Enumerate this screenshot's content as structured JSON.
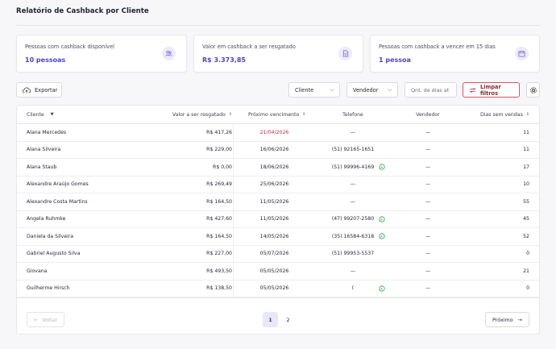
{
  "page": {
    "title": "Relatório de Cashback por Cliente"
  },
  "cards": [
    {
      "label": "Pessoas com cashback disponível",
      "value": "10 pessoas",
      "icon": "people-icon"
    },
    {
      "label": "Valor em cashback a ser resgatado",
      "value": "R$ 3.373,85",
      "icon": "document-icon"
    },
    {
      "label": "Pessoas com cashback a vencer em 15 dias",
      "value": "1 pessoa",
      "icon": "calendar-icon"
    }
  ],
  "toolbar": {
    "export_label": "Exportar",
    "client_filter": "Cliente",
    "seller_filter": "Vendedor",
    "days_placeholder": "Qnt. de dias at",
    "clear_label": "Limpar filtros"
  },
  "table": {
    "headers": {
      "cliente": "Cliente",
      "valor": "Valor a ser resgatado",
      "proximo": "Próximo vencimento",
      "telefone": "Telefone",
      "vendedor": "Vendedor",
      "dias": "Dias sem vendas"
    },
    "rows": [
      {
        "cliente": "Alana Mercedes",
        "valor": "R$ 417,26",
        "proximo": "21/04/2026",
        "telefone": "—",
        "whatsapp": false,
        "vendedor": "—",
        "dias": "11",
        "soon": true
      },
      {
        "cliente": "Alana Silveira",
        "valor": "R$ 229,00",
        "proximo": "16/06/2026",
        "telefone": "(51) 92165-1651",
        "whatsapp": false,
        "vendedor": "—",
        "dias": "11",
        "soon": false
      },
      {
        "cliente": "Alana Staub",
        "valor": "R$ 0,00",
        "proximo": "18/06/2026",
        "telefone": "(51) 99996-4169",
        "whatsapp": true,
        "vendedor": "—",
        "dias": "17",
        "soon": false
      },
      {
        "cliente": "Alexandre Araújo Gomes",
        "valor": "R$ 269,49",
        "proximo": "25/06/2026",
        "telefone": "—",
        "whatsapp": false,
        "vendedor": "—",
        "dias": "10",
        "soon": false
      },
      {
        "cliente": "Alexandre Costa Martins",
        "valor": "R$ 164,50",
        "proximo": "11/05/2026",
        "telefone": "—",
        "whatsapp": false,
        "vendedor": "—",
        "dias": "55",
        "soon": false
      },
      {
        "cliente": "Angela Ruhmke",
        "valor": "R$ 427,60",
        "proximo": "11/05/2026",
        "telefone": "(47) 99207-2580",
        "whatsapp": true,
        "vendedor": "—",
        "dias": "45",
        "soon": false
      },
      {
        "cliente": "Daniela da Silveira",
        "valor": "R$ 164,50",
        "proximo": "14/05/2026",
        "telefone": "(35) 16584-6318",
        "whatsapp": true,
        "vendedor": "—",
        "dias": "52",
        "soon": false
      },
      {
        "cliente": "Gabriel Augusto Silva",
        "valor": "R$ 227,00",
        "proximo": "05/07/2026",
        "telefone": "(51) 99953-5537",
        "whatsapp": false,
        "vendedor": "—",
        "dias": "0",
        "soon": false
      },
      {
        "cliente": "Giovana",
        "valor": "R$ 493,50",
        "proximo": "05/05/2026",
        "telefone": "—",
        "whatsapp": false,
        "vendedor": "—",
        "dias": "21",
        "soon": false
      },
      {
        "cliente": "Guilherme Hirsch",
        "valor": "R$ 138,50",
        "proximo": "05/05/2026",
        "telefone": "(",
        "whatsapp": true,
        "vendedor": "—",
        "dias": "0",
        "soon": false
      }
    ]
  },
  "pagination": {
    "back_label": "Voltar",
    "next_label": "Próximo",
    "pages": [
      "1",
      "2"
    ],
    "current": "1"
  },
  "colors": {
    "accent": "#4a46c8",
    "danger": "#c0313d",
    "whatsapp": "#2aa84a"
  }
}
